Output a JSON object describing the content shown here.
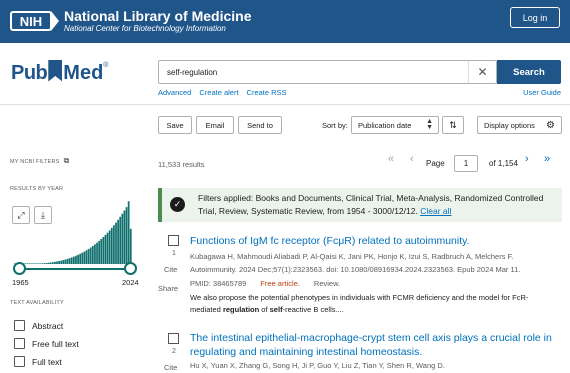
{
  "header": {
    "nih_badge": "NIH",
    "title": "National Library of Medicine",
    "subtitle": "National Center for Biotechnology Information",
    "login_label": "Log in",
    "brand_color": "#20558a"
  },
  "logo": {
    "pub": "Pub",
    "med": "Med",
    "registered": "®"
  },
  "search": {
    "query": "self-regulation",
    "clear_icon": "close-icon",
    "button_label": "Search",
    "links": [
      "Advanced",
      "Create alert",
      "Create RSS"
    ],
    "user_guide": "User Guide"
  },
  "toolbar": {
    "save": "Save",
    "email": "Email",
    "send_to": "Send to",
    "sort_by_label": "Sort by:",
    "sort_value": "Publication date",
    "display_options": "Display options"
  },
  "sidebar": {
    "my_ncbi_filters": "MY NCBI FILTERS",
    "results_by_year": "RESULTS BY YEAR",
    "year_start": "1965",
    "year_end": "2024",
    "text_availability": "TEXT AVAILABILITY",
    "availability_options": [
      "Abstract",
      "Free full text",
      "Full text"
    ],
    "histogram_color": "#0e6f6d"
  },
  "results": {
    "count": "11,533 results",
    "page_label": "Page",
    "page_value": "1",
    "page_total": "of 1,154",
    "filter_banner": {
      "text": "Filters applied: Books and Documents, Clinical Trial, Meta-Analysis, Randomized Controlled Trial, Review, Systematic Review, from 1954 - 3000/12/12.",
      "clear_all": "Clear all"
    },
    "items": [
      {
        "number": "1",
        "title": "Functions of IgM fc receptor (FcμR) related to autoimmunity.",
        "authors": "Kubagawa H, Mahmoudi Aliabadi P, Al-Qaisi K, Jani PK, Honjo K, Izui S, Radbruch A, Melchers F.",
        "citation": "Autoimmunity. 2024 Dec;57(1):2323563. doi: 10.1080/08916934.2024.2323563. Epub 2024 Mar 11.",
        "pmid": "PMID: 38465789",
        "free": "Free article.",
        "type": "Review.",
        "snippet_1": "We also propose the potential phenotypes in individuals with FCMR deficiency and the model for FcR-",
        "snippet_2_pre": "mediated ",
        "snippet_2_bold1": "regulation",
        "snippet_2_mid": " of ",
        "snippet_2_bold2": "self",
        "snippet_2_post": "-reactive B cells....",
        "cite": "Cite",
        "share": "Share"
      },
      {
        "number": "2",
        "title": "The intestinal epithelial-macrophage-crypt stem cell axis plays a crucial role in regulating and maintaining intestinal homeostasis.",
        "authors": "Hu X, Yuan X, Zhang G, Song H, Ji P, Guo Y, Liu Z, Tian Y, Shen R, Wang D.",
        "cite": "Cite"
      }
    ]
  }
}
